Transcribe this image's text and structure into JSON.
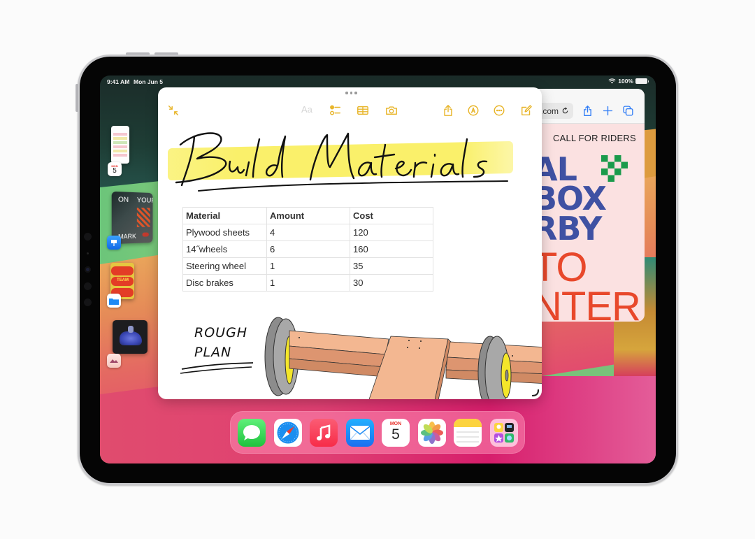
{
  "device": {
    "status_bar": {
      "time": "9:41 AM",
      "date": "Mon Jun 5",
      "battery_percent": "100%",
      "battery_level": 1.0,
      "wifi": "wifi-icon"
    }
  },
  "stage_manager": {
    "recent_apps": [
      {
        "app": "Calendar",
        "badge_day": "MON",
        "badge_num": "5"
      },
      {
        "app": "Keynote",
        "thumb_text_1": "ON",
        "thumb_text_2": "YOUR",
        "thumb_text_3": "MARK"
      },
      {
        "app": "Files",
        "thumb_text": "TEAM"
      },
      {
        "app": "Reality Composer"
      }
    ]
  },
  "notes": {
    "toolbar": {
      "collapse": "collapse-icon",
      "format_label": "Aa",
      "checklist": "checklist-icon",
      "table": "table-icon",
      "camera": "camera-icon",
      "share": "share-icon",
      "markup": "markup-icon",
      "more": "more-icon",
      "compose": "compose-icon"
    },
    "title_handwritten": "Build Materials",
    "table": {
      "headers": [
        "Material",
        "Amount",
        "Cost"
      ],
      "rows": [
        [
          "Plywood sheets",
          "4",
          "120"
        ],
        [
          "14˝wheels",
          "6",
          "160"
        ],
        [
          "Steering wheel",
          "1",
          "35"
        ],
        [
          "Disc brakes",
          "1",
          "30"
        ]
      ]
    },
    "sketch_label_line1": "ROUGH",
    "sketch_label_line2": "PLAN"
  },
  "safari": {
    "url_fragment": ".com",
    "toolbar": {
      "reload": "reload-icon",
      "share": "share-icon",
      "new_tab": "plus-icon",
      "tabs": "tabs-icon"
    },
    "page": {
      "kicker": "CALL FOR RIDERS",
      "line1": "AL",
      "line2": "BOX",
      "line3": "RBY",
      "line4": "TO",
      "line5": "NTER"
    }
  },
  "dock": {
    "apps": [
      {
        "name": "Messages"
      },
      {
        "name": "Safari"
      },
      {
        "name": "Music"
      },
      {
        "name": "Mail"
      },
      {
        "name": "Calendar",
        "day": "MON",
        "num": "5"
      },
      {
        "name": "Photos"
      },
      {
        "name": "Notes"
      },
      {
        "name": "App Folder"
      }
    ]
  },
  "colors": {
    "notes_accent": "#e8b52a",
    "safari_accent": "#2f7cf6",
    "poster_blue": "#3f51a3",
    "poster_orange": "#e8482b",
    "poster_green": "#1a9a4b",
    "highlighter": "#faf06a"
  }
}
